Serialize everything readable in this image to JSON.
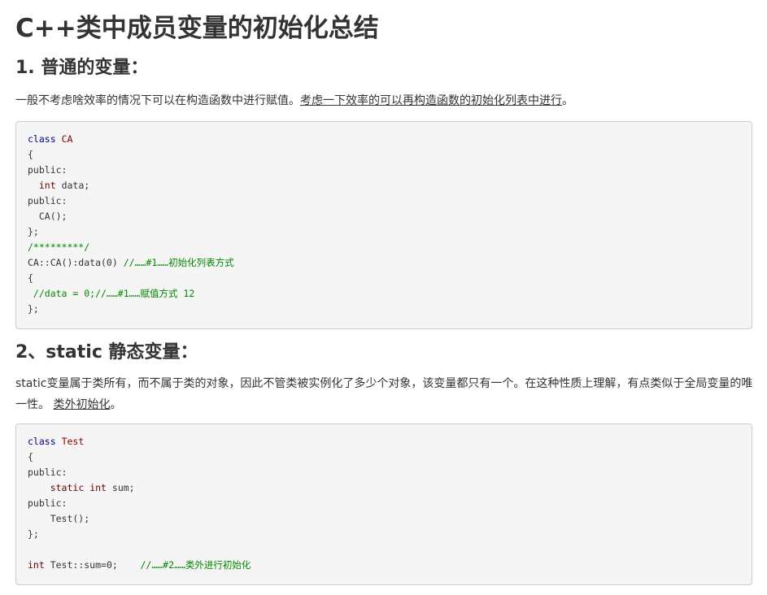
{
  "title": "C++类中成员变量的初始化总结",
  "section1": {
    "heading": "1. 普通的变量：",
    "text_plain": "一般不考虑啥效率的情况下可以在构造函数中进行赋值。",
    "text_link": "考虑一下效率的可以再构造函数的初始化列表中进行",
    "text_end": "。",
    "code": {
      "l1_kw": "class",
      "l1_name": "CA",
      "l2": "{",
      "l3": "public:",
      "l4_indent": "  ",
      "l4_type": "int",
      "l4_rest": " data;",
      "l5": "public:",
      "l6": "  CA();",
      "l7": "};",
      "l8": "/*********/",
      "l9_code": "CA::CA():data(0) ",
      "l9_comment": "//……#1……初始化列表方式",
      "l10": "{",
      "l11_comment": " //data = 0;//……#1……赋值方式 12",
      "l12": "};"
    }
  },
  "section2": {
    "heading": "2、static 静态变量：",
    "text_plain": "static变量属于类所有，而不属于类的对象，因此不管类被实例化了多少个对象，该变量都只有一个。在这种性质上理解，有点类似于全局变量的唯一性。 ",
    "text_link": "类外初始化",
    "text_end": "。",
    "code": {
      "l1_kw": "class",
      "l1_name": "Test",
      "l2": "{",
      "l3": "public:",
      "l4_indent": "    ",
      "l4_kw": "static",
      "l4_type": "int",
      "l4_rest": " sum;",
      "l5": "public:",
      "l6": "    Test();",
      "l7": "};",
      "l9_type": "int",
      "l9_code": " Test::sum=0;    ",
      "l9_comment": "//……#2……类外进行初始化"
    }
  }
}
